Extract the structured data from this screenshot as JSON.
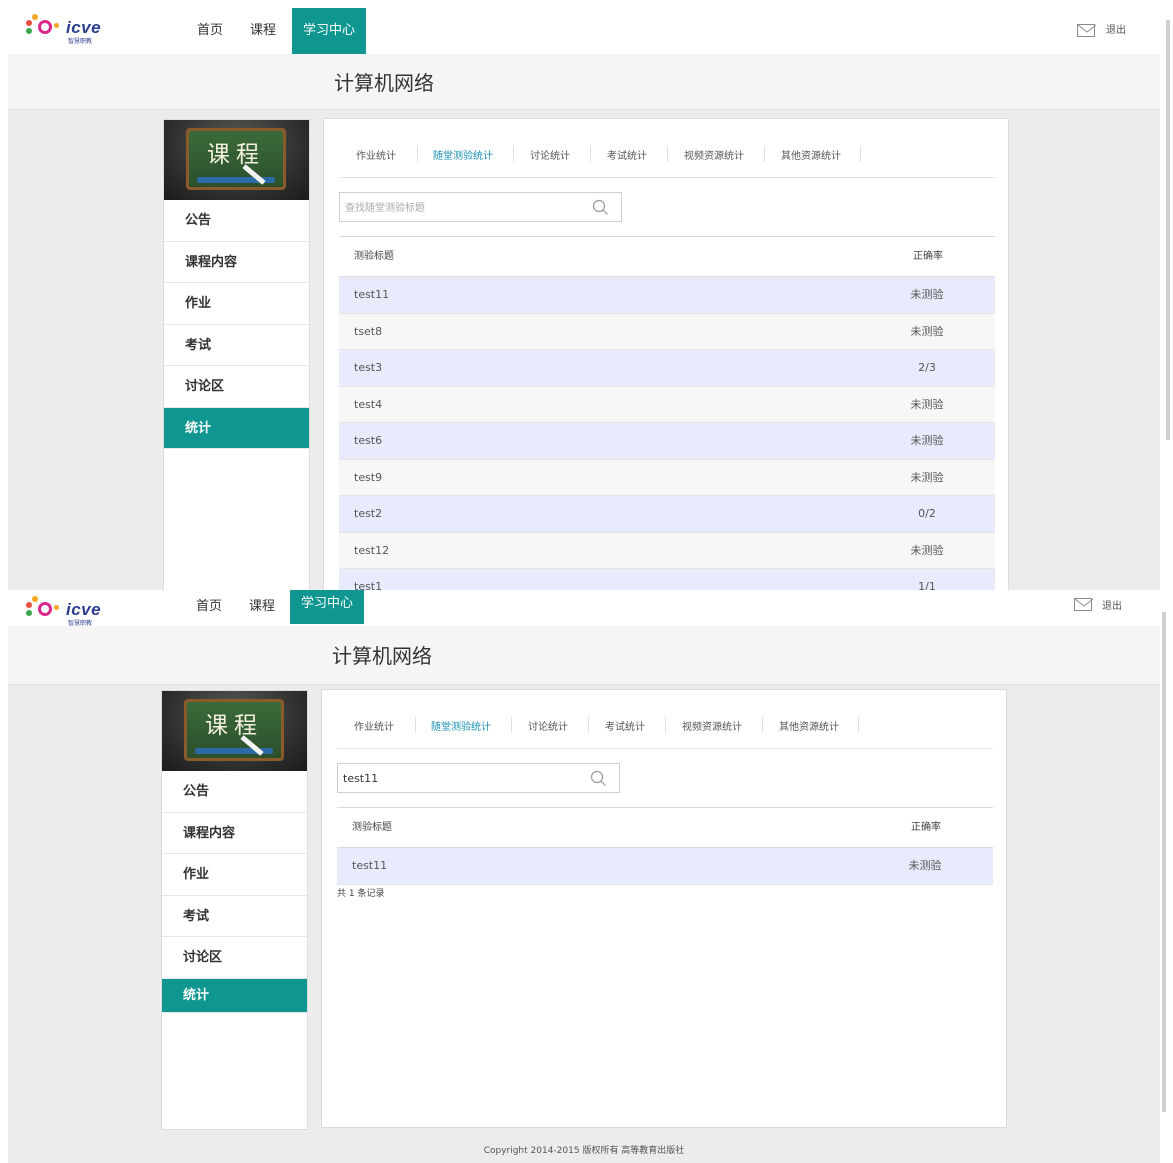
{
  "header": {
    "logo_text": "icve",
    "logo_sub": "智慧职教",
    "nav": [
      "首页",
      "课程",
      "学习中心"
    ],
    "active_nav": "学习中心",
    "logout_label": "退出"
  },
  "course_title": "计算机网络",
  "course_image_text": "课程",
  "sidebar": {
    "items": [
      "公告",
      "课程内容",
      "作业",
      "考试",
      "讨论区",
      "统计"
    ],
    "active": "统计"
  },
  "tabs": [
    "作业统计",
    "随堂测验统计",
    "讨论统计",
    "考试统计",
    "视频资源统计",
    "其他资源统计"
  ],
  "active_tab": "随堂测验统计",
  "search": {
    "placeholder": "查找随堂测验标题",
    "value_after": "test11"
  },
  "table": {
    "col_title": "测验标题",
    "col_rate": "正确率",
    "rows": [
      {
        "title": "test11",
        "rate": "未测验"
      },
      {
        "title": "tset8",
        "rate": "未测验"
      },
      {
        "title": "test3",
        "rate": "2/3"
      },
      {
        "title": "test4",
        "rate": "未测验"
      },
      {
        "title": "test6",
        "rate": "未测验"
      },
      {
        "title": "test9",
        "rate": "未测验"
      },
      {
        "title": "test2",
        "rate": "0/2"
      },
      {
        "title": "test12",
        "rate": "未测验"
      },
      {
        "title": "test1",
        "rate": "1/1"
      }
    ],
    "filtered_rows": [
      {
        "title": "test11",
        "rate": "未测验"
      }
    ]
  },
  "record_count": "共 1 条记录",
  "footer": "Copyright 2014-2015 版权所有 高等教育出版社",
  "colors": {
    "accent": "#0f9690",
    "tab_active": "#1a8fb5",
    "row_highlight": "#e8ebfb"
  }
}
